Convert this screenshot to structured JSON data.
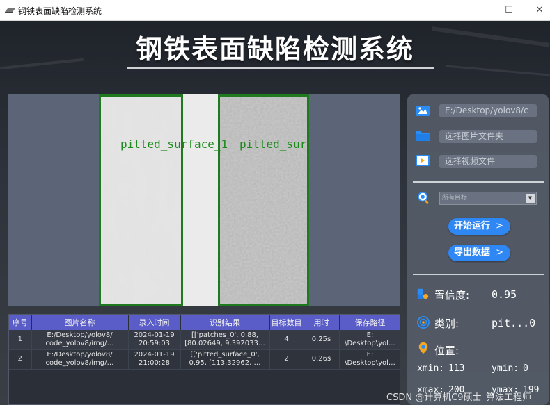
{
  "window": {
    "title": "钢铁表面缺陷检测系统",
    "minimize_glyph": "—",
    "maximize_glyph": "☐",
    "close_glyph": "✕"
  },
  "header": {
    "title": "钢铁表面缺陷检测系统"
  },
  "detections": [
    {
      "label": "pitted_surface_1"
    },
    {
      "label": "pitted_surf"
    }
  ],
  "table": {
    "columns": [
      "序号",
      "图片名称",
      "录入时间",
      "识别结果",
      "目标数目",
      "用时",
      "保存路径"
    ],
    "rows": [
      [
        "1",
        "E:/Desktop/yolov8/\ncode_yolov8/img/…",
        "2024-01-19\n20:59:03",
        "[['patches_0', 0.88,\n[80.02649, 9.392033…",
        "4",
        "0.25s",
        "E:\n\\Desktop\\yol…"
      ],
      [
        "2",
        "E:/Desktop/yolov8/\ncode_yolov8/img/…",
        "2024-01-19\n21:00:28",
        "[['pitted_surface_0',\n0.95, [113.32962, …",
        "2",
        "0.26s",
        "E:\n\\Desktop\\yol…"
      ]
    ]
  },
  "sidebar": {
    "image_path_value": "E:/Desktop/yolov8/c",
    "folder_placeholder": "选择图片文件夹",
    "video_placeholder": "选择视频文件",
    "target_select_value": "所有目标",
    "run_button": "开始运行",
    "export_button": "导出数据",
    "confidence_label": "置信度:",
    "confidence_value": "0.95",
    "class_label": "类别:",
    "class_value": "pit...0",
    "position_label": "位置:",
    "xmin_label": "xmin:",
    "xmin_value": "113",
    "ymin_label": "ymin:",
    "ymin_value": "0",
    "xmax_label": "xmax:",
    "xmax_value": "200",
    "ymax_label": "ymax:",
    "ymax_value": "199"
  },
  "watermark": "CSDN @计算机C9硕士_算法工程师",
  "colors": {
    "accent_button": "#2f87f3",
    "table_header": "#5a5dc7",
    "detection_box": "#1f7a1f"
  },
  "icons": {
    "app": "steel-plate-icon",
    "image_file": "image-file-icon",
    "folder": "folder-icon",
    "video": "video-file-icon",
    "target": "target-search-icon",
    "confidence": "confidence-icon",
    "class": "class-target-icon",
    "position": "location-pin-icon"
  }
}
